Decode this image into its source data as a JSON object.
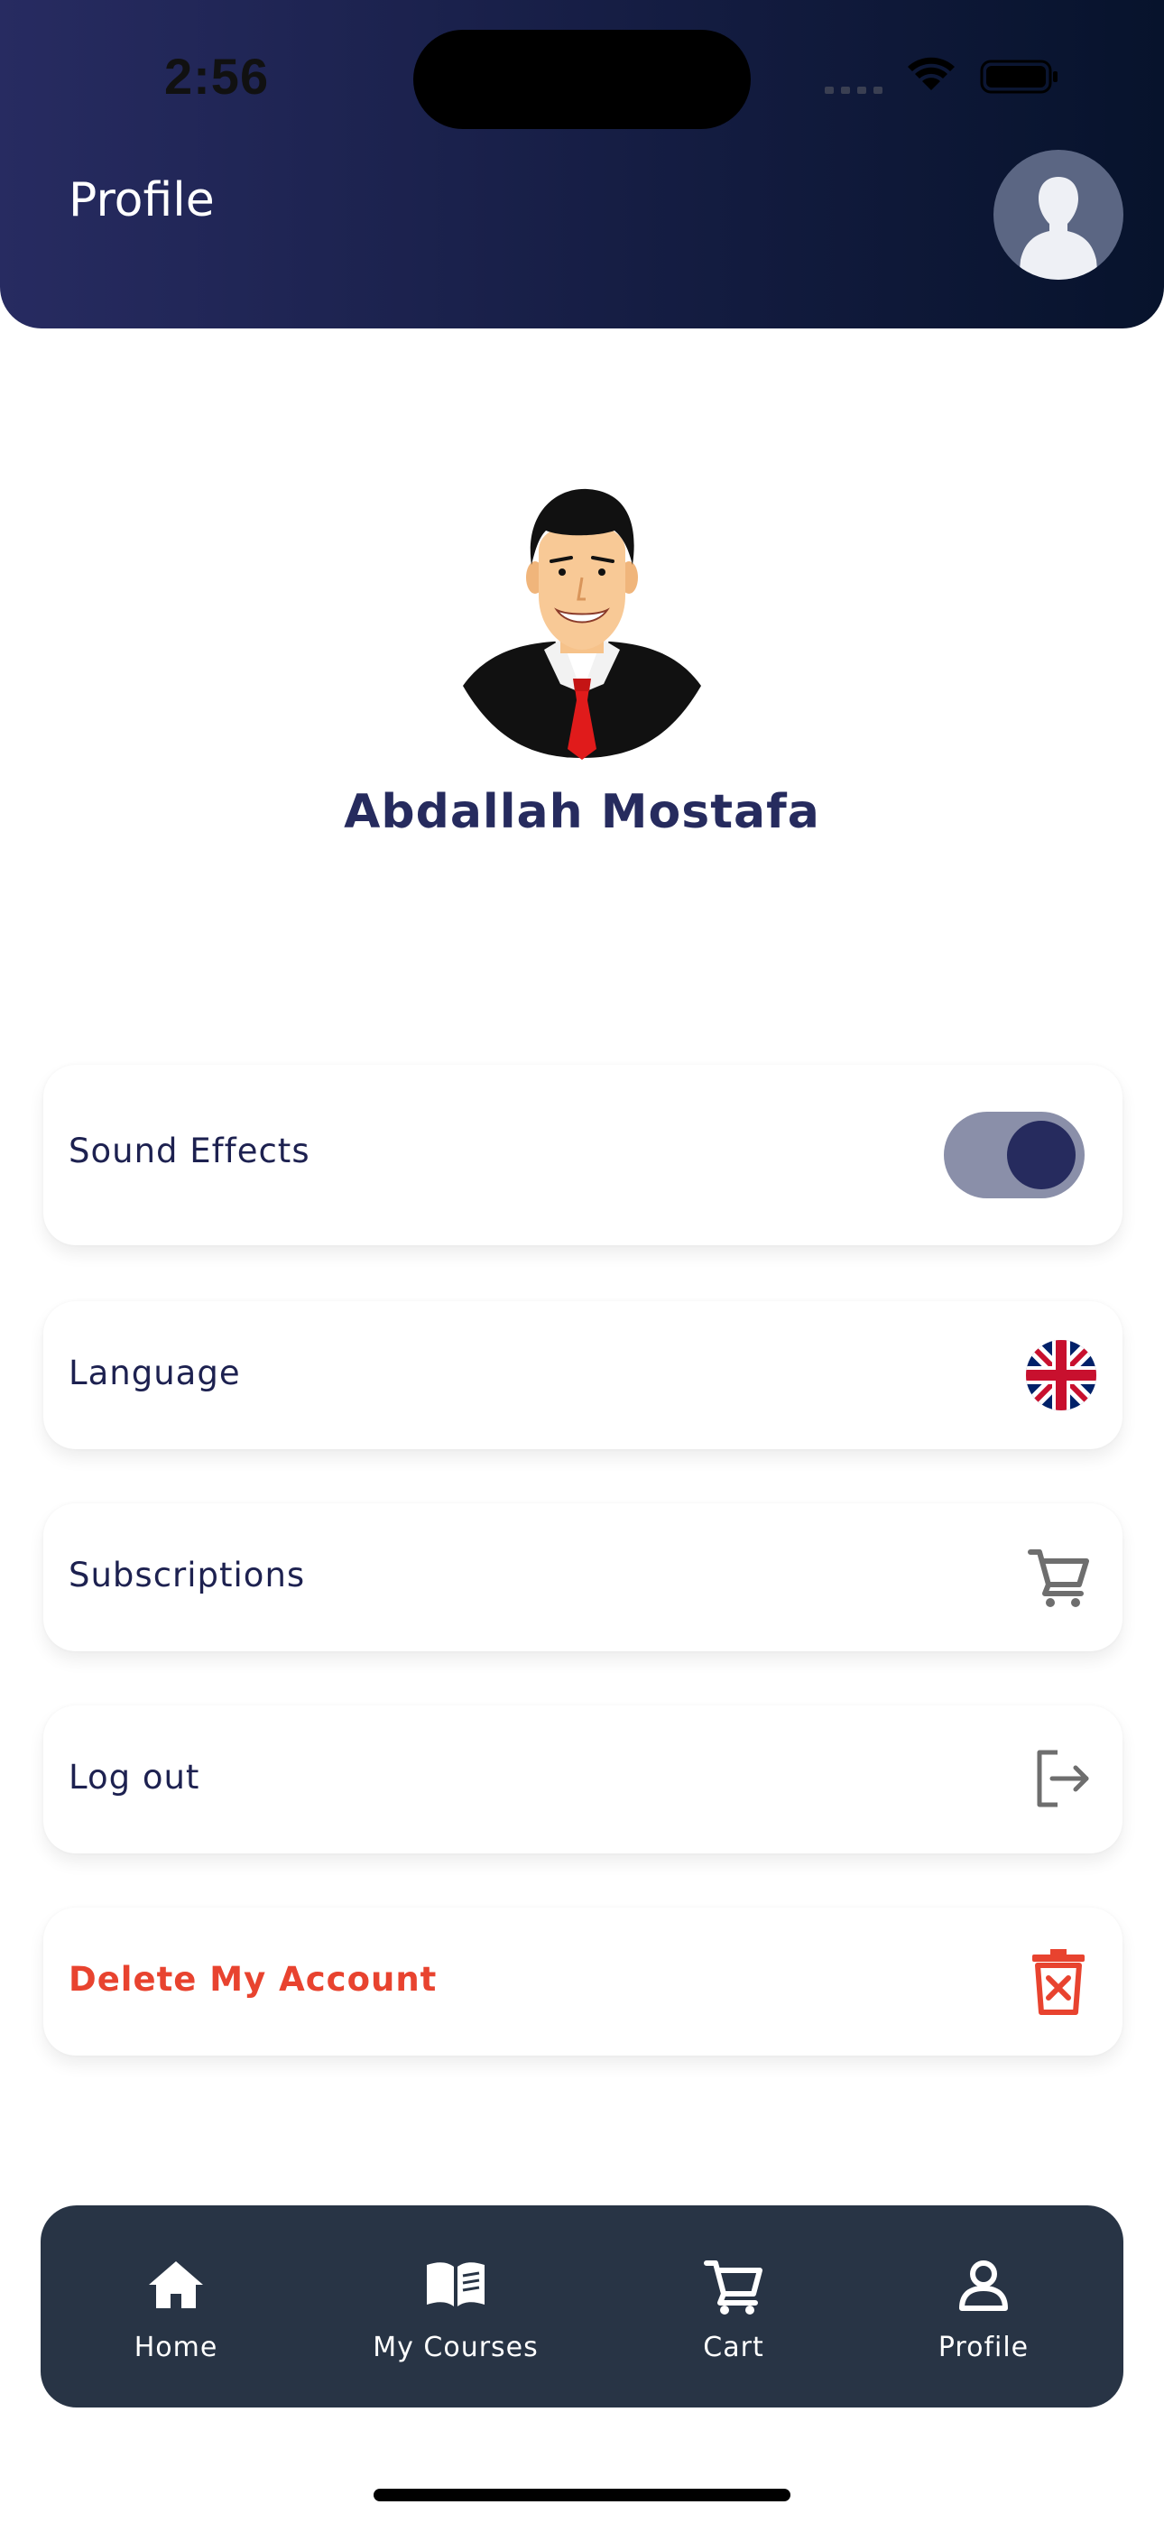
{
  "status_bar": {
    "time": "2:56"
  },
  "header": {
    "title": "Profile",
    "avatar_icon": "user-silhouette-icon"
  },
  "profile": {
    "name": "Abdallah Mostafa",
    "avatar_icon": "businessman-avatar-icon"
  },
  "settings": {
    "sound_effects": {
      "label": "Sound Effects",
      "enabled": true
    },
    "language": {
      "label": "Language",
      "icon": "uk-flag-icon"
    },
    "subscriptions": {
      "label": "Subscriptions",
      "icon": "cart-icon"
    },
    "logout": {
      "label": "Log out",
      "icon": "logout-icon"
    },
    "delete_account": {
      "label": "Delete My Account",
      "icon": "trash-icon",
      "color": "#e8432f"
    }
  },
  "bottom_nav": {
    "items": [
      {
        "label": "Home",
        "icon": "home-icon"
      },
      {
        "label": "My Courses",
        "icon": "book-icon"
      },
      {
        "label": "Cart",
        "icon": "cart-icon"
      },
      {
        "label": "Profile",
        "icon": "user-icon"
      }
    ]
  },
  "colors": {
    "header_gradient_start": "#272b61",
    "header_gradient_end": "#07132c",
    "primary": "#262b5e",
    "nav_background": "#283445",
    "danger": "#e8432f"
  }
}
